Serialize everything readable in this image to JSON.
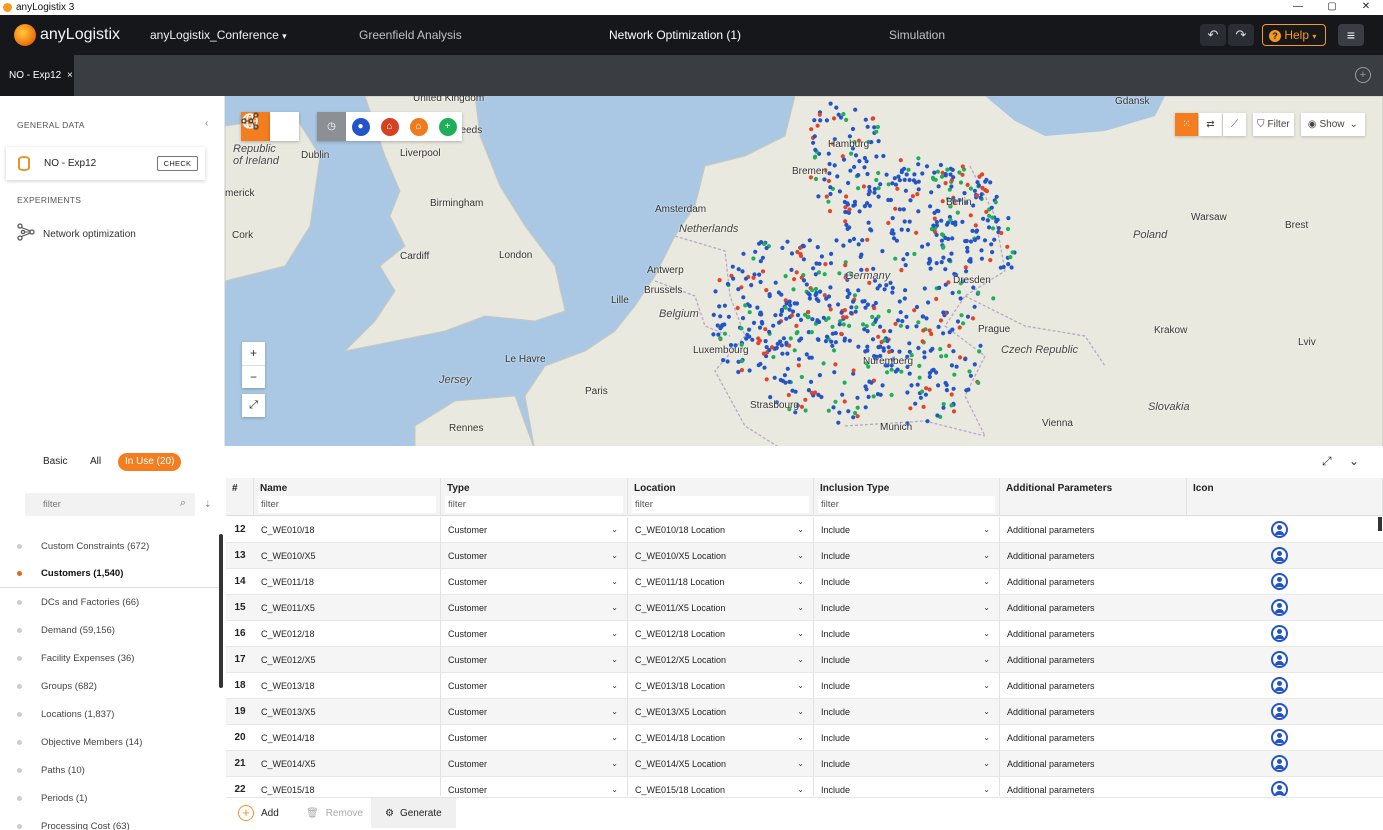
{
  "window": {
    "title": "anyLogistix 3",
    "controls": [
      "—",
      "▢",
      "✕"
    ]
  },
  "header": {
    "brand": "anyLogistix",
    "project": "anyLogistix_Conference",
    "tabs": [
      {
        "label": "Greenfield Analysis"
      },
      {
        "label": "Network Optimization (1)"
      },
      {
        "label": "Simulation"
      }
    ],
    "undo": "↶",
    "redo": "↷",
    "help": "Help",
    "menu": "≡"
  },
  "experiment_tab": {
    "label": "NO - Exp12",
    "close": "×"
  },
  "left_panel": {
    "general_heading": "GENERAL DATA",
    "dataset": {
      "name": "NO - Exp12",
      "check": "CHECK"
    },
    "experiments_heading": "EXPERIMENTS",
    "experiments": [
      {
        "label": "Network optimization"
      }
    ]
  },
  "map": {
    "labels": [
      {
        "text": "Republic\nof Ireland",
        "cls": "big"
      },
      {
        "text": "Dublin"
      },
      {
        "text": "Liverpool"
      },
      {
        "text": "Leeds"
      },
      {
        "text": "United Kingdom"
      },
      {
        "text": "Birmingham"
      },
      {
        "text": "Cork"
      },
      {
        "text": "Cardiff"
      },
      {
        "text": "London"
      },
      {
        "text": "merick"
      },
      {
        "text": "Amsterdam"
      },
      {
        "text": "Netherlands",
        "cls": "big"
      },
      {
        "text": "Antwerp"
      },
      {
        "text": "Brussels"
      },
      {
        "text": "Belgium",
        "cls": "big"
      },
      {
        "text": "Lille"
      },
      {
        "text": "Luxembourg"
      },
      {
        "text": "Le Havre"
      },
      {
        "text": "Jersey",
        "cls": "big"
      },
      {
        "text": "Paris"
      },
      {
        "text": "Rennes"
      },
      {
        "text": "Strasbourg"
      },
      {
        "text": "Hamburg"
      },
      {
        "text": "Bremen"
      },
      {
        "text": "Germany",
        "cls": "big"
      },
      {
        "text": "Nuremberg"
      },
      {
        "text": "Munich"
      },
      {
        "text": "Berlin"
      },
      {
        "text": "Dresden"
      },
      {
        "text": "Prague"
      },
      {
        "text": "Czech Republic",
        "cls": "big"
      },
      {
        "text": "Vienna"
      },
      {
        "text": "Slovakia",
        "cls": "big"
      },
      {
        "text": "Poland",
        "cls": "big"
      },
      {
        "text": "Warsaw"
      },
      {
        "text": "Brest"
      },
      {
        "text": "Krakow"
      },
      {
        "text": "Lviv"
      },
      {
        "text": "Gdansk"
      }
    ],
    "filter_label": "Filter",
    "show_label": "Show"
  },
  "bottom_tabs": {
    "basic": "Basic",
    "all": "All",
    "in_use": "In Use (20)"
  },
  "categories": {
    "filter_placeholder": "filter",
    "items": [
      {
        "label": "Custom Constraints (672)"
      },
      {
        "label": "Customers (1,540)",
        "active": true
      },
      {
        "label": "DCs and Factories (66)"
      },
      {
        "label": "Demand (59,156)"
      },
      {
        "label": "Facility Expenses (36)"
      },
      {
        "label": "Groups (682)"
      },
      {
        "label": "Locations (1,837)"
      },
      {
        "label": "Objective Members (14)"
      },
      {
        "label": "Paths (10)"
      },
      {
        "label": "Periods (1)"
      },
      {
        "label": "Processing Cost (63)"
      }
    ]
  },
  "table": {
    "columns": [
      {
        "label": "#",
        "filter": ""
      },
      {
        "label": "Name",
        "filter": "filter"
      },
      {
        "label": "Type",
        "filter": "filter"
      },
      {
        "label": "Location",
        "filter": "filter"
      },
      {
        "label": "Inclusion Type",
        "filter": "filter"
      },
      {
        "label": "Additional Parameters",
        "filter": ""
      },
      {
        "label": "Icon",
        "filter": ""
      }
    ],
    "rows": [
      {
        "num": "12",
        "name": "C_WE010/18",
        "type": "Customer",
        "location": "C_WE010/18 Location",
        "inclusion": "Include",
        "params": "Additional parameters"
      },
      {
        "num": "13",
        "name": "C_WE010/X5",
        "type": "Customer",
        "location": "C_WE010/X5 Location",
        "inclusion": "Include",
        "params": "Additional parameters"
      },
      {
        "num": "14",
        "name": "C_WE011/18",
        "type": "Customer",
        "location": "C_WE011/18 Location",
        "inclusion": "Include",
        "params": "Additional parameters"
      },
      {
        "num": "15",
        "name": "C_WE011/X5",
        "type": "Customer",
        "location": "C_WE011/X5 Location",
        "inclusion": "Include",
        "params": "Additional parameters"
      },
      {
        "num": "16",
        "name": "C_WE012/18",
        "type": "Customer",
        "location": "C_WE012/18 Location",
        "inclusion": "Include",
        "params": "Additional parameters"
      },
      {
        "num": "17",
        "name": "C_WE012/X5",
        "type": "Customer",
        "location": "C_WE012/X5 Location",
        "inclusion": "Include",
        "params": "Additional parameters"
      },
      {
        "num": "18",
        "name": "C_WE013/18",
        "type": "Customer",
        "location": "C_WE013/18 Location",
        "inclusion": "Include",
        "params": "Additional parameters"
      },
      {
        "num": "19",
        "name": "C_WE013/X5",
        "type": "Customer",
        "location": "C_WE013/X5 Location",
        "inclusion": "Include",
        "params": "Additional parameters"
      },
      {
        "num": "20",
        "name": "C_WE014/18",
        "type": "Customer",
        "location": "C_WE014/18 Location",
        "inclusion": "Include",
        "params": "Additional parameters"
      },
      {
        "num": "21",
        "name": "C_WE014/X5",
        "type": "Customer",
        "location": "C_WE014/X5 Location",
        "inclusion": "Include",
        "params": "Additional parameters"
      },
      {
        "num": "22",
        "name": "C_WE015/18",
        "type": "Customer",
        "location": "C_WE015/18 Location",
        "inclusion": "Include",
        "params": "Additional parameters"
      }
    ]
  },
  "footer": {
    "add": "Add",
    "remove": "Remove",
    "generate": "Generate"
  },
  "colors": {
    "accent": "#f47d20",
    "header_bg": "#15171b",
    "customer_blue": "#2354c8",
    "dc_green": "#1fae5a",
    "factory_red": "#e0452b"
  }
}
